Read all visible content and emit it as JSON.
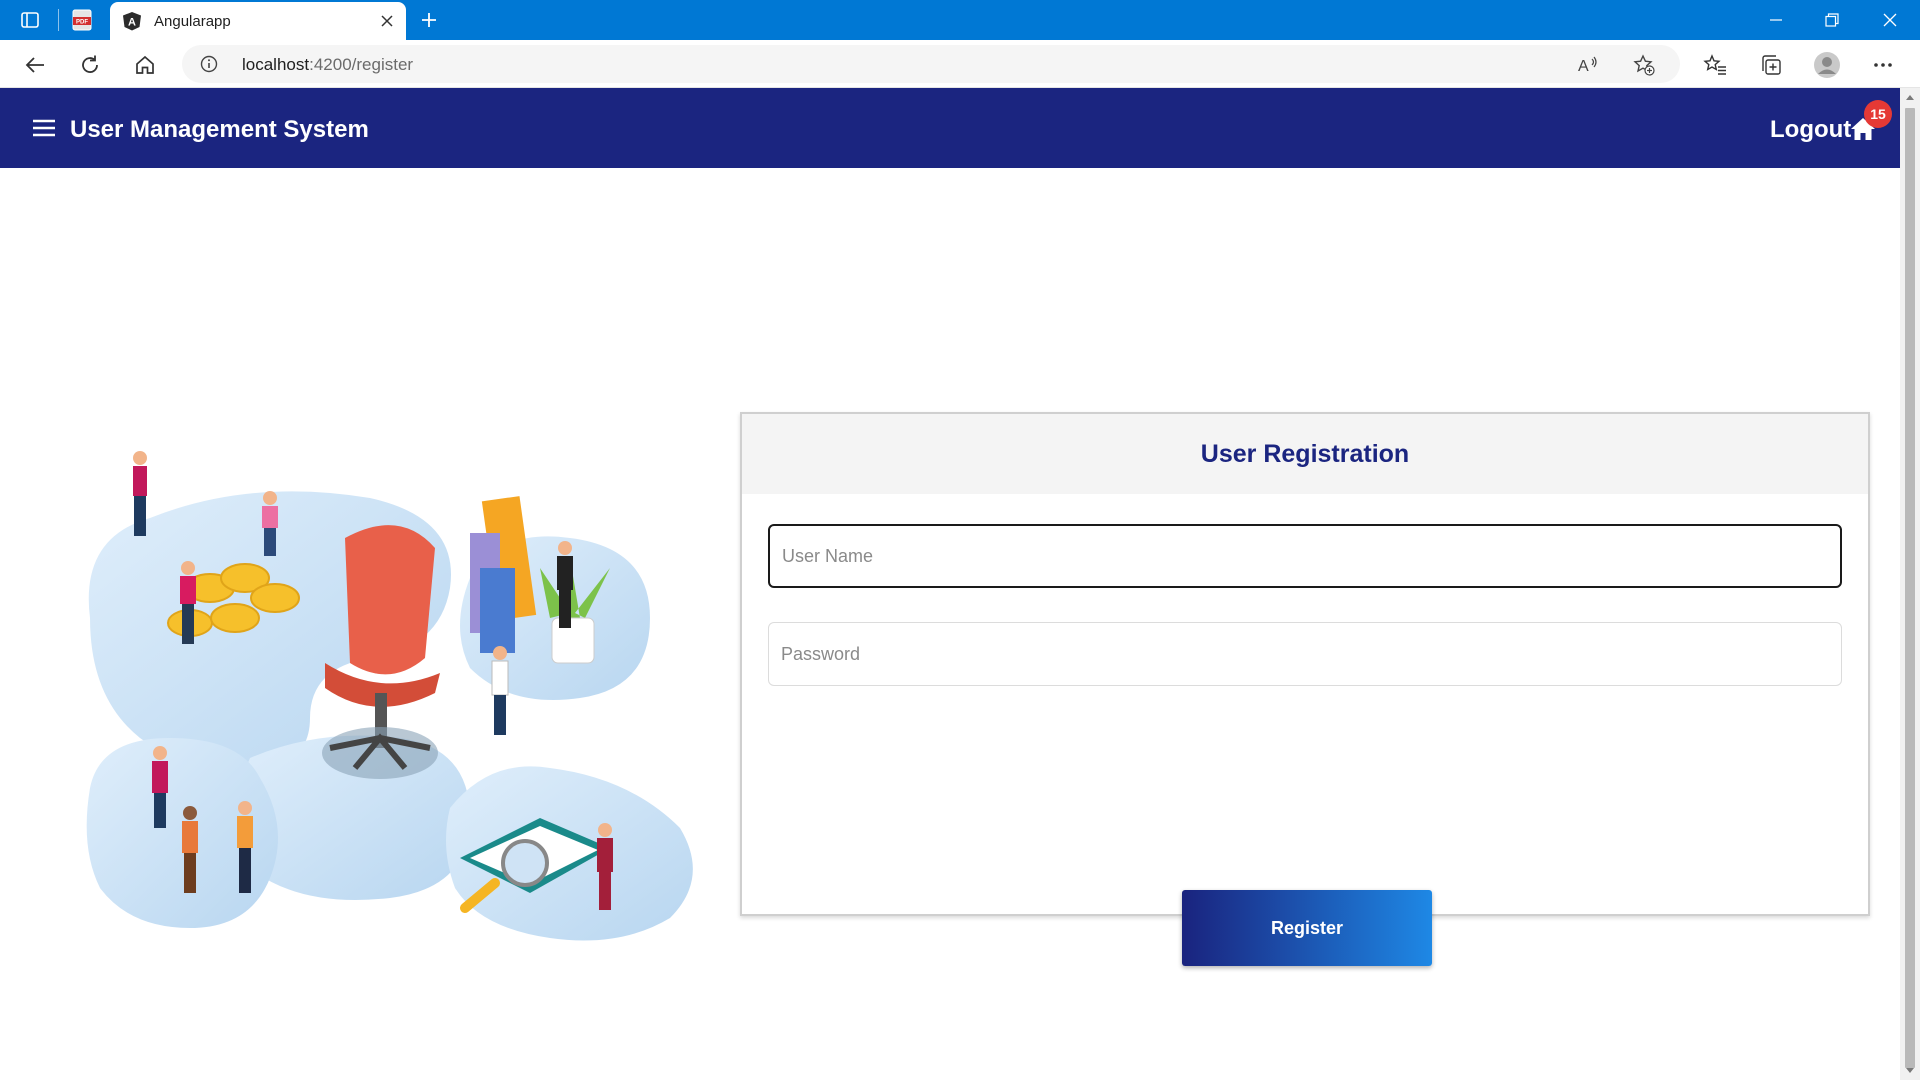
{
  "browser": {
    "tab_title": "Angularapp",
    "url_host": "localhost",
    "url_path": ":4200/register"
  },
  "app": {
    "title": "User Management System",
    "logout_label": "Logout",
    "notification_count": "15"
  },
  "registration": {
    "heading": "User Registration",
    "username_placeholder": "User Name",
    "password_placeholder": "Password",
    "submit_label": "Register"
  },
  "colors": {
    "toolbar": "#1b2580",
    "accent_start": "#1a237e",
    "accent_end": "#1e88e5",
    "badge": "#e53935",
    "browser_tabbar": "#0078d4"
  }
}
